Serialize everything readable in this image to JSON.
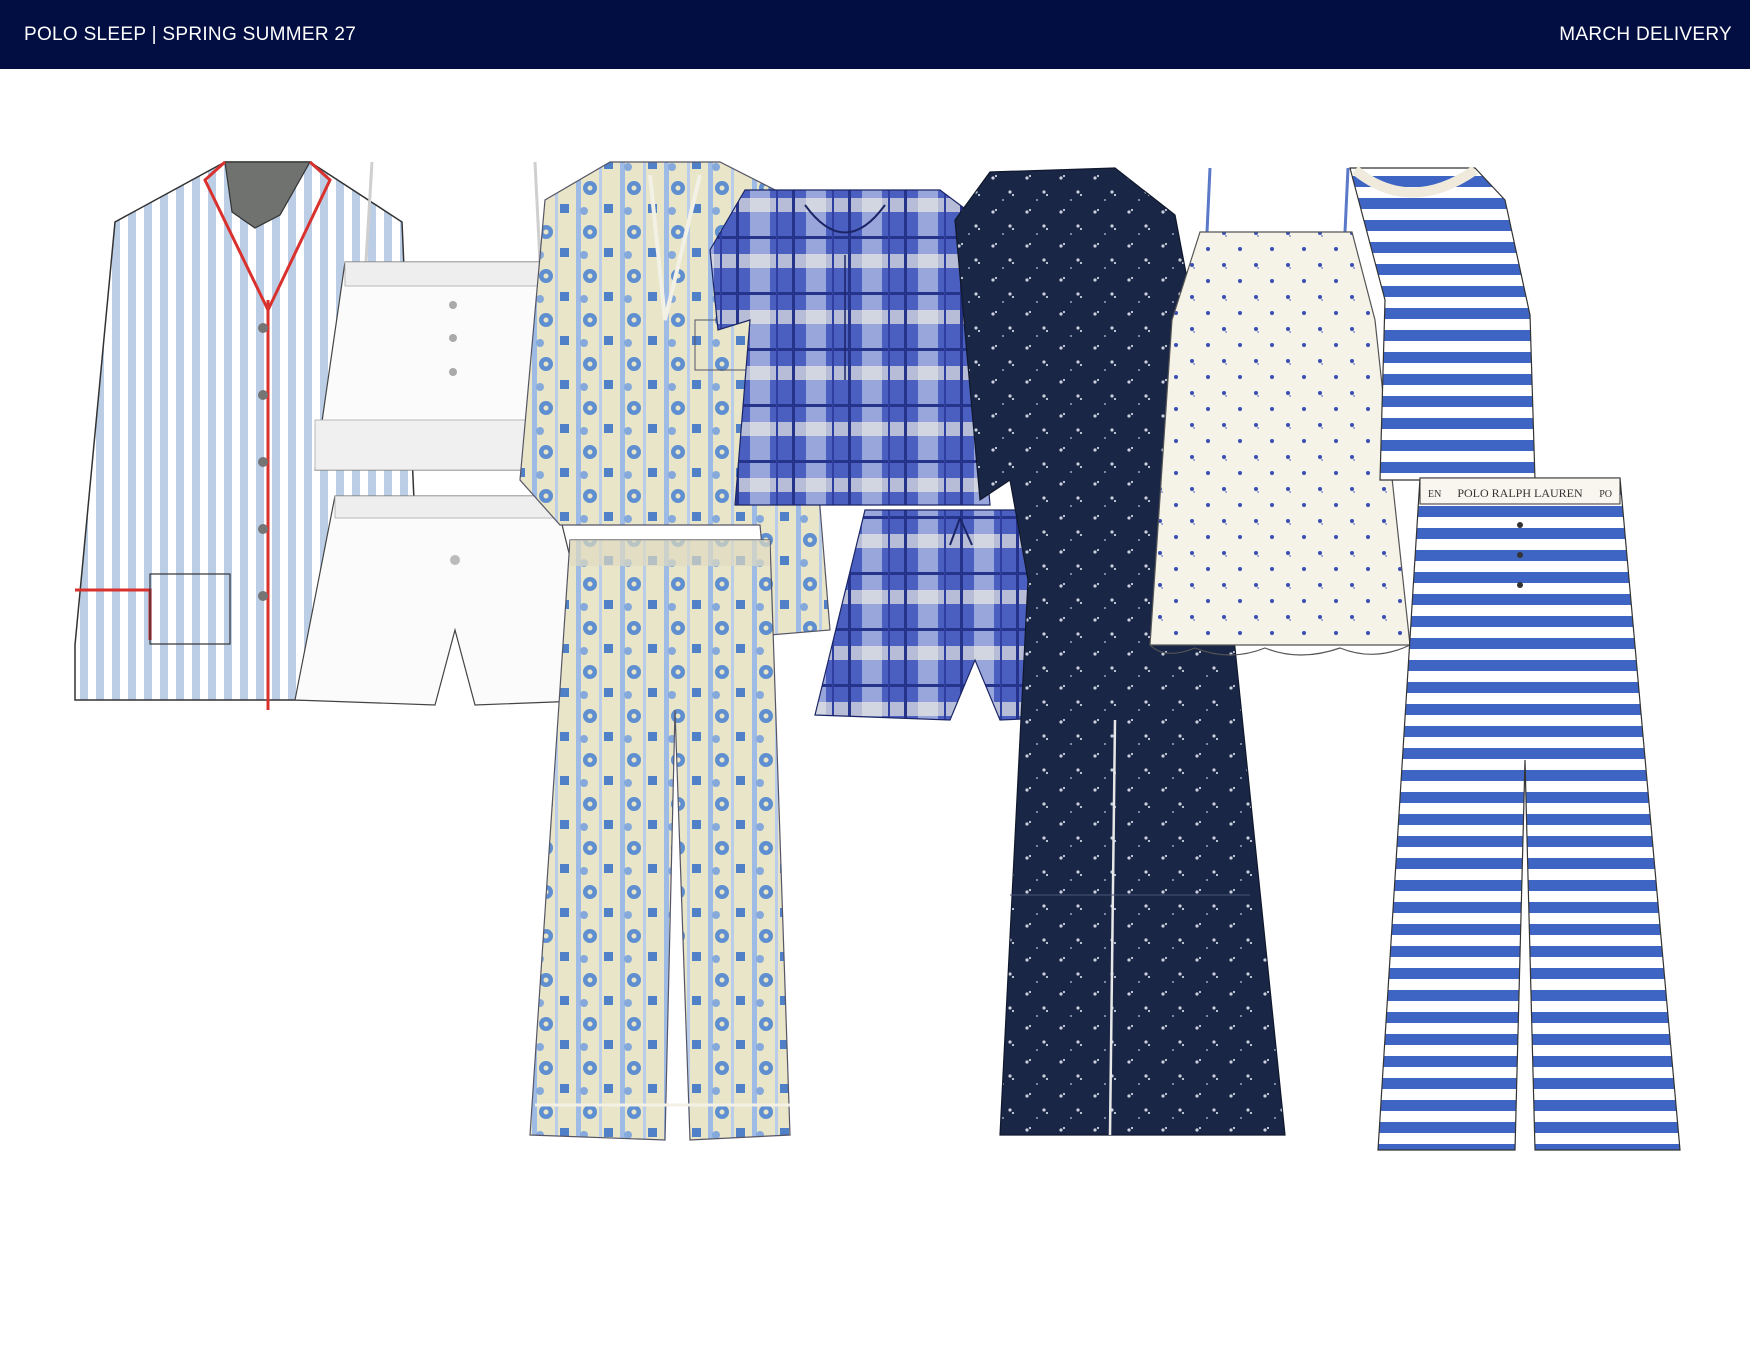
{
  "header": {
    "left_title": "POLO SLEEP | SPRING SUMMER 27",
    "right_title": "MARCH DELIVERY"
  },
  "lineup": {
    "pant_waistband_text": "POLO RALPH LAUREN",
    "pant_waistband_left": "EN",
    "pant_waistband_right": "PO"
  },
  "colors": {
    "header_bg": "#020e42",
    "pale_stripe": "#bccee6",
    "piping_red": "#d8312e",
    "floral_cream": "#e9e5c8",
    "floral_blue": "#5f8fd0",
    "plaid_blue": "#3b4fb3",
    "navy_print": "#1a2645",
    "stripe_blue": "#3f65c4"
  }
}
